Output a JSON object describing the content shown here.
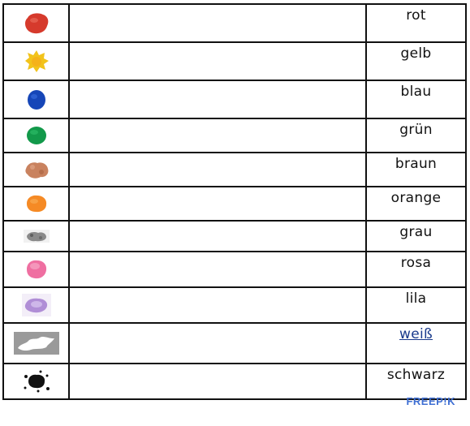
{
  "rows": [
    {
      "word": "rot",
      "icon": "red-paint-blot-icon",
      "color": "#d63a2c"
    },
    {
      "word": "gelb",
      "icon": "yellow-paint-blot-icon",
      "color": "#f2c31b"
    },
    {
      "word": "blau",
      "icon": "blue-paint-blot-icon",
      "color": "#1646b8"
    },
    {
      "word": "grün",
      "icon": "green-paint-blot-icon",
      "color": "#12994a"
    },
    {
      "word": "braun",
      "icon": "brown-paint-blot-icon",
      "color": "#c9825f"
    },
    {
      "word": "orange",
      "icon": "orange-paint-blot-icon",
      "color": "#f58a25"
    },
    {
      "word": "grau",
      "icon": "grey-paint-blot-icon",
      "color": "#8a8a8a"
    },
    {
      "word": "rosa",
      "icon": "pink-paint-blot-icon",
      "color": "#ef6fa1"
    },
    {
      "word": "lila",
      "icon": "purple-paint-blot-icon",
      "color": "#b08ed6"
    },
    {
      "word": "weiß",
      "icon": "white-paint-blot-icon",
      "color": "#ffffff"
    },
    {
      "word": "schwarz",
      "icon": "black-paint-blot-icon",
      "color": "#111111"
    }
  ],
  "watermark": "FREEP!K"
}
